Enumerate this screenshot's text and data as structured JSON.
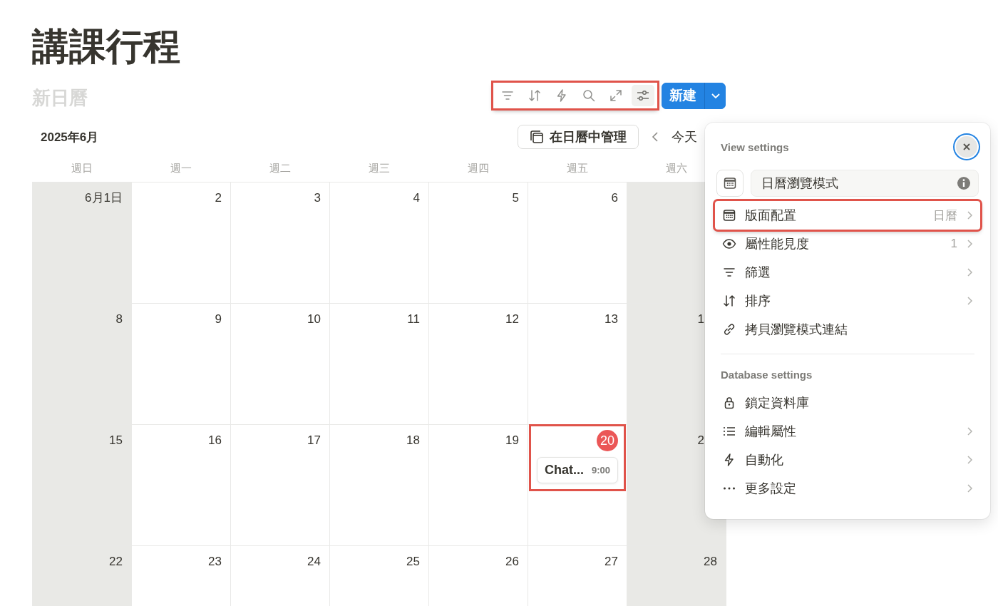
{
  "page_title": "講課行程",
  "view_name": "新日曆",
  "toolbar": {
    "highlighted": true,
    "tools": [
      {
        "kind": "filter",
        "selected": false
      },
      {
        "kind": "sort",
        "selected": false
      },
      {
        "kind": "bolt",
        "selected": false
      },
      {
        "kind": "search",
        "selected": false
      },
      {
        "kind": "expand",
        "selected": false
      },
      {
        "kind": "settings",
        "selected": true
      }
    ]
  },
  "new_button": {
    "label": "新建"
  },
  "month": "2025年6月",
  "manage_button": "在日曆中管理",
  "today_button": "今天",
  "weekdays": [
    "週日",
    "週一",
    "週二",
    "週三",
    "週四",
    "週五",
    "週六"
  ],
  "weeks": [
    [
      {
        "label": "6月1日",
        "weekend": true
      },
      {
        "label": "2",
        "weekend": false
      },
      {
        "label": "3",
        "weekend": false
      },
      {
        "label": "4",
        "weekend": false
      },
      {
        "label": "5",
        "weekend": false
      },
      {
        "label": "6",
        "weekend": false
      },
      {
        "weekend": true
      }
    ],
    [
      {
        "label": "8",
        "weekend": true
      },
      {
        "label": "9",
        "weekend": false
      },
      {
        "label": "10",
        "weekend": false
      },
      {
        "label": "11",
        "weekend": false
      },
      {
        "label": "12",
        "weekend": false
      },
      {
        "label": "13",
        "weekend": false
      },
      {
        "label": "1",
        "weekend": true
      }
    ],
    [
      {
        "label": "15",
        "weekend": true
      },
      {
        "label": "16",
        "weekend": false
      },
      {
        "label": "17",
        "weekend": false
      },
      {
        "label": "18",
        "weekend": false
      },
      {
        "label": "19",
        "weekend": false
      },
      {
        "label": "20",
        "weekend": false,
        "today": true,
        "highlighted": true,
        "events": [
          {
            "title": "Chat...",
            "time": "9:00"
          }
        ]
      },
      {
        "label": "2",
        "weekend": true
      }
    ],
    [
      {
        "label": "22",
        "weekend": true
      },
      {
        "label": "23",
        "weekend": false
      },
      {
        "label": "24",
        "weekend": false
      },
      {
        "label": "25",
        "weekend": false
      },
      {
        "label": "26",
        "weekend": false
      },
      {
        "label": "27",
        "weekend": false
      },
      {
        "label": "28",
        "weekend": true
      }
    ]
  ],
  "view_settings": {
    "heading": "View settings",
    "view_name": "日曆瀏覽模式",
    "items": [
      {
        "kind": "calendar",
        "label": "版面配置",
        "value": "日曆",
        "arrow": true,
        "highlighted": true
      },
      {
        "kind": "eye",
        "label": "屬性能見度",
        "value": "1",
        "arrow": true,
        "highlighted": false
      },
      {
        "kind": "filter",
        "label": "篩選",
        "arrow": true,
        "highlighted": false
      },
      {
        "kind": "sort",
        "label": "排序",
        "arrow": true,
        "highlighted": false
      },
      {
        "kind": "link",
        "label": "拷貝瀏覽模式連結",
        "arrow": false,
        "highlighted": false
      }
    ],
    "database_heading": "Database settings",
    "database_items": [
      {
        "kind": "lock",
        "label": "鎖定資料庫",
        "arrow": false,
        "highlighted": false
      },
      {
        "kind": "list",
        "label": "編輯屬性",
        "arrow": true,
        "highlighted": false
      },
      {
        "kind": "bolt",
        "label": "自動化",
        "arrow": true,
        "highlighted": false
      },
      {
        "kind": "dots",
        "label": "更多設定",
        "arrow": true,
        "highlighted": false
      }
    ]
  }
}
